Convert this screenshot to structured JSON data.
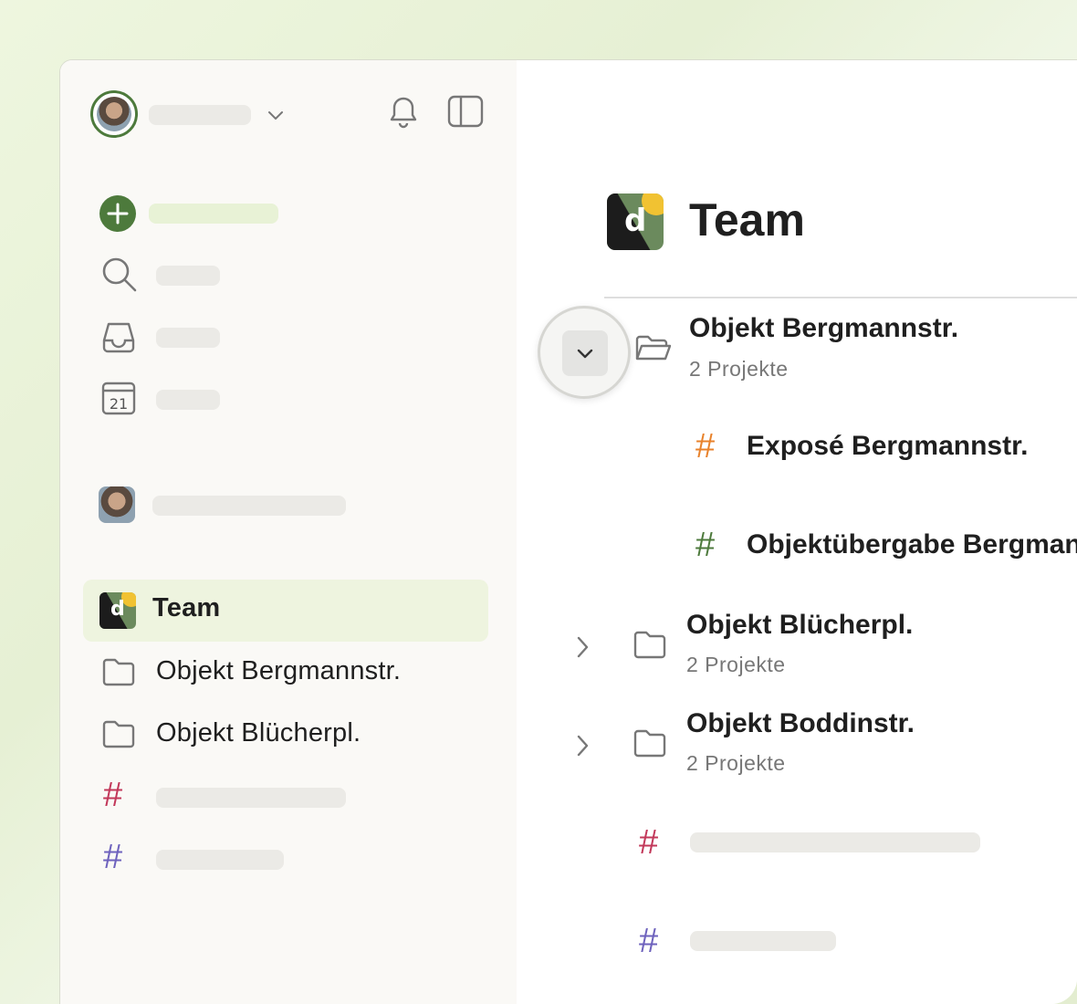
{
  "colors": {
    "accent_green": "#4d7a3c",
    "hash_orange": "#e8822b",
    "hash_green": "#4d7a3c",
    "hash_red": "#c2385a",
    "hash_purple": "#6e62bd"
  },
  "sidebar": {
    "team_label": "Team",
    "folders": [
      {
        "label": "Objekt Bergmannstr.",
        "icon": "folder-icon"
      },
      {
        "label": "Objekt Blücherpl.",
        "icon": "folder-icon"
      }
    ]
  },
  "calendar_day": "21",
  "logo_letter": "d",
  "main": {
    "title": "Team",
    "groups": [
      {
        "title": "Objekt Bergmannstr.",
        "subtitle": "2 Projekte",
        "expanded": true,
        "projects": [
          {
            "name": "Exposé Bergmannstr.",
            "color": "#e8822b"
          },
          {
            "name": "Objektübergabe Bergmannstr.",
            "color": "#4d7a3c"
          }
        ]
      },
      {
        "title": "Objekt Blücherpl.",
        "subtitle": "2 Projekte",
        "expanded": false
      },
      {
        "title": "Objekt Boddinstr.",
        "subtitle": "2 Projekte",
        "expanded": false
      }
    ]
  },
  "hash_symbol": "#"
}
